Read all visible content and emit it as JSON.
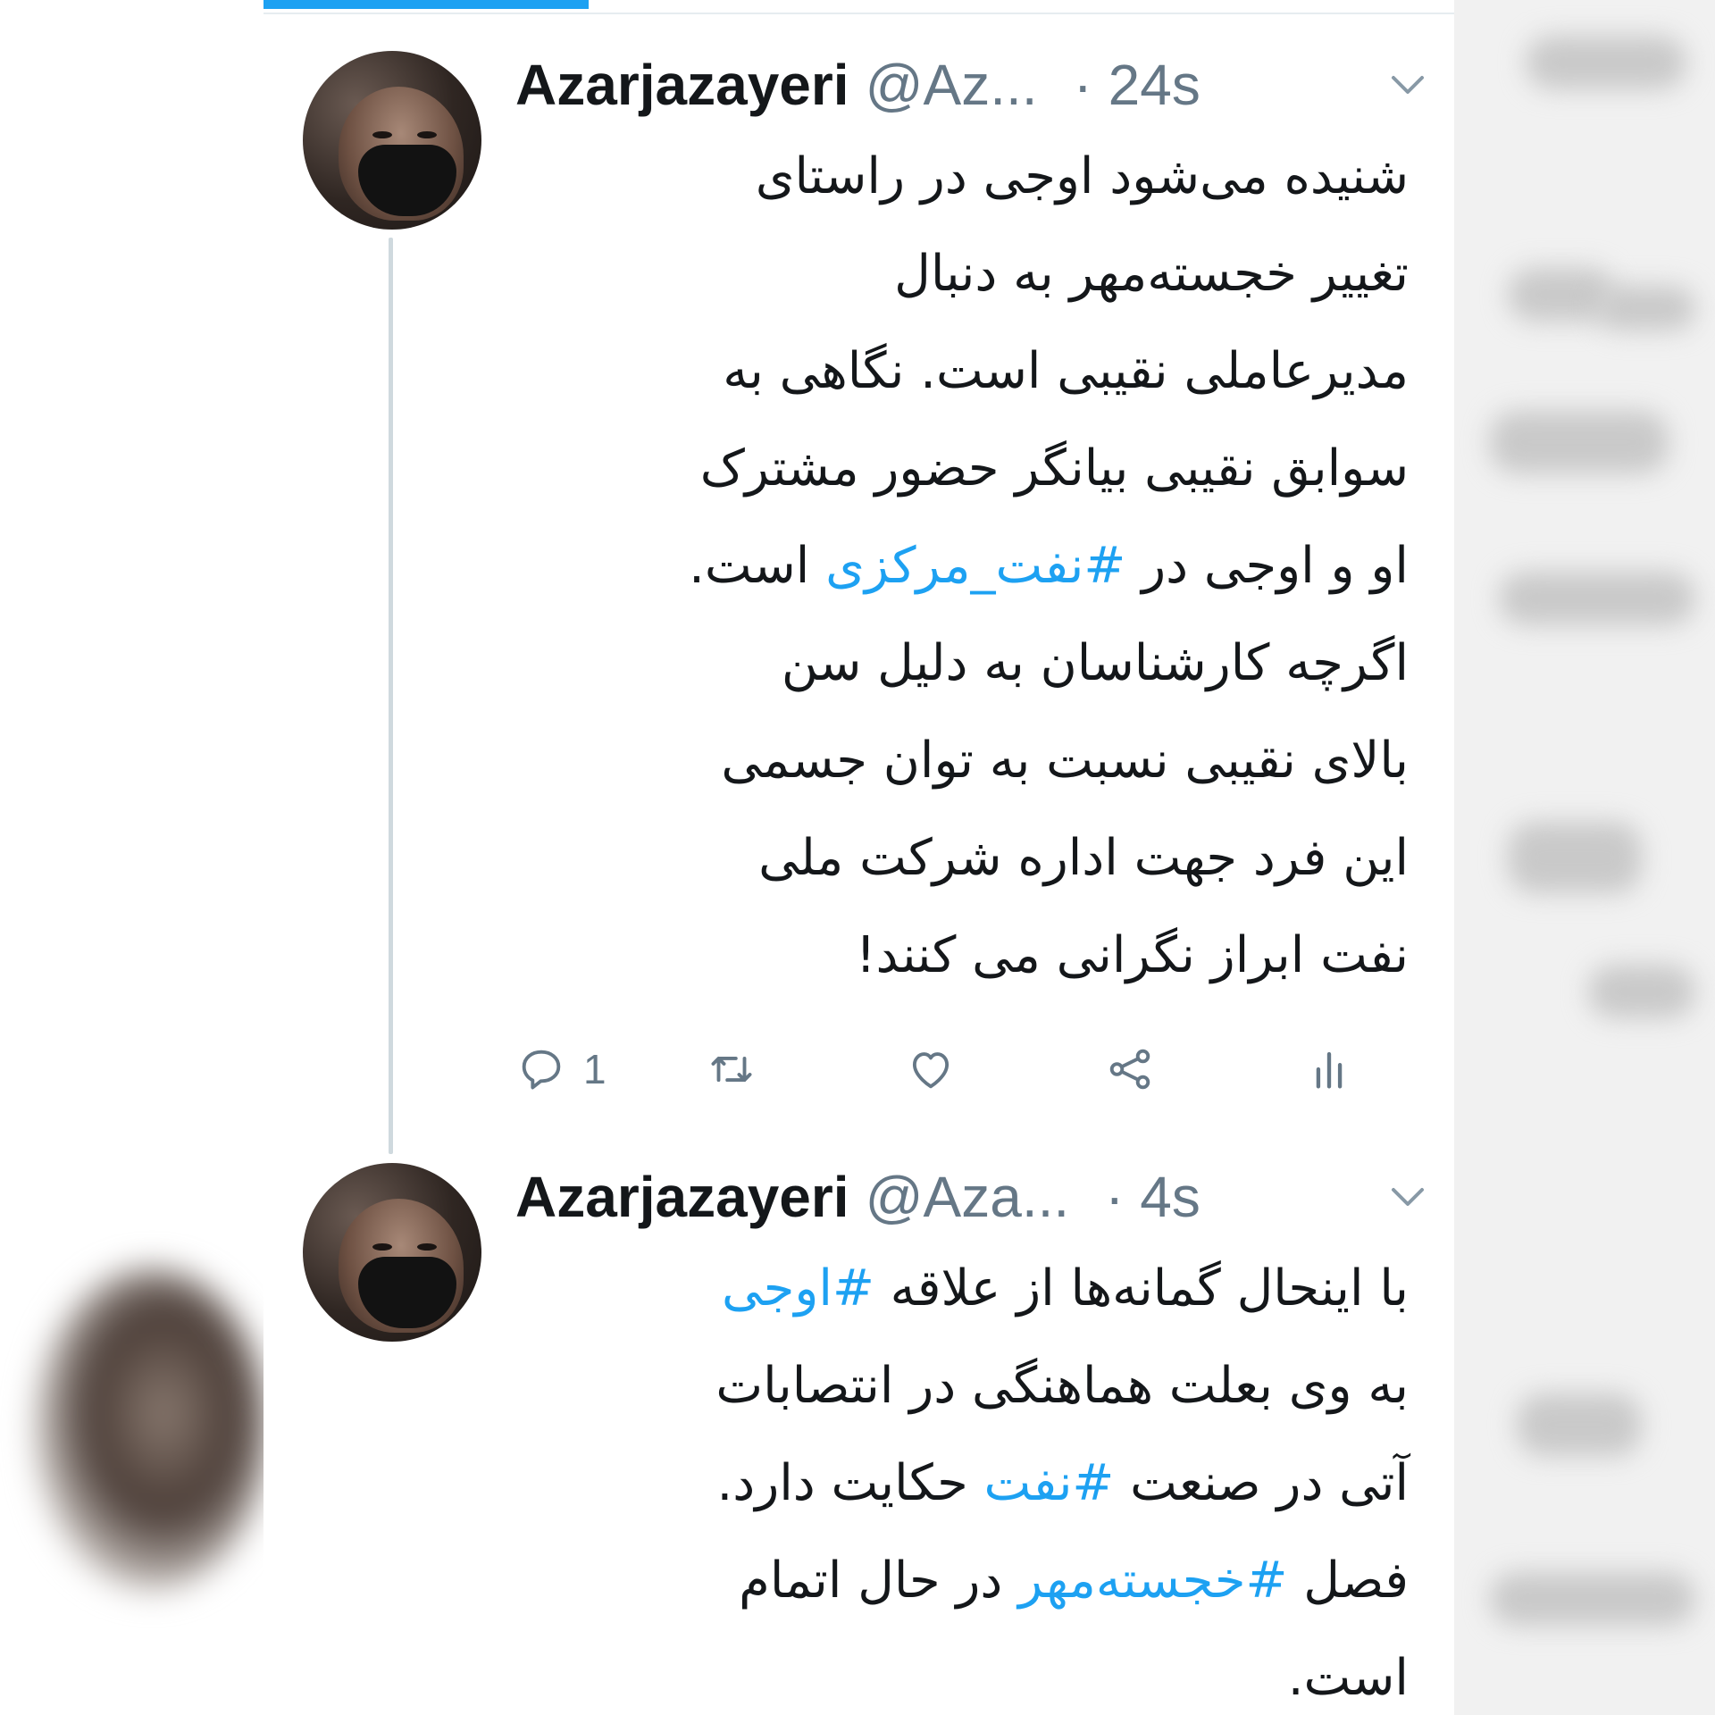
{
  "tweets": [
    {
      "name": "Azarjazayeri",
      "handle": "@Az...",
      "time": "· 24s",
      "lines": [
        "شنیده می‌شود اوجی در راستای",
        "تغییر خجسته‌مهر به دنبال",
        "مدیرعاملی نقیبی است. نگاهی به",
        "سوابق نقیبی بیانگر حضور مشترک",
        "او و اوجی در ",
        "اگرچه کارشناسان به دلیل سن",
        "بالای نقیبی نسبت به توان جسمی",
        "این فرد جهت اداره شرکت ملی",
        "نفت ابراز نگرانی می کنند!"
      ],
      "line5_hashtag": "#نفت_مرکزی",
      "line5_tail": " است.",
      "reply_count": "1",
      "icons": [
        "reply-icon",
        "retweet-icon",
        "like-icon",
        "share-icon",
        "stats-icon"
      ]
    },
    {
      "name": "Azarjazayeri",
      "handle": "@Aza...",
      "time": "· 4s",
      "line1_text": "با اینحال گمانه‌ها از علاقه ",
      "line1_hashtag": "#اوجی",
      "line2": "به وی بعلت هماهنگی در انتصابات",
      "line3_text": "آتی در صنعت ",
      "line3_hashtag": "#نفت",
      "line3_tail": " حکایت دارد.",
      "line4_text": "فصل ",
      "line4_hashtag": "#خجسته‌مهر",
      "line4_tail": " در حال اتمام",
      "line5": "است."
    }
  ],
  "colors": {
    "accent": "#1da1f2",
    "text": "#14171a",
    "secondary": "#657786",
    "thread_line": "#cfd9de"
  }
}
